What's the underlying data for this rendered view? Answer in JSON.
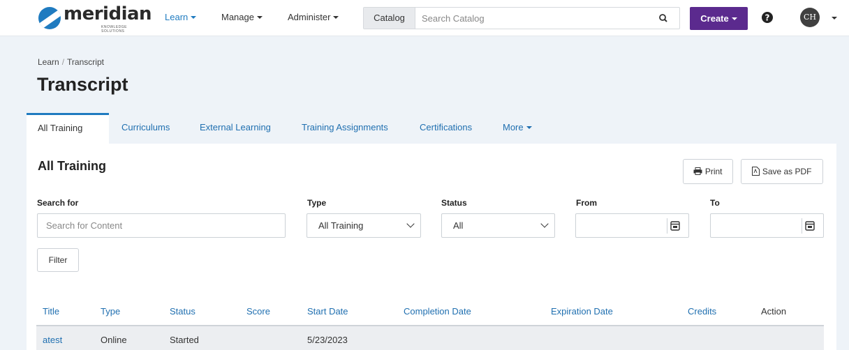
{
  "brand": {
    "name": "meridian",
    "tagline": "KNOWLEDGE SOLUTIONS"
  },
  "nav": {
    "learn": "Learn",
    "manage": "Manage",
    "administer": "Administer",
    "catalog_label": "Catalog",
    "search_placeholder": "Search Catalog",
    "create": "Create",
    "avatar_initials": "CH"
  },
  "breadcrumb": {
    "root": "Learn",
    "current": "Transcript"
  },
  "page_title": "Transcript",
  "tabs": [
    "All Training",
    "Curriculums",
    "External Learning",
    "Training Assignments",
    "Certifications",
    "More"
  ],
  "panel": {
    "title": "All Training",
    "print": "Print",
    "save_pdf": "Save as PDF",
    "filters": {
      "search_label": "Search for",
      "search_placeholder": "Search for Content",
      "type_label": "Type",
      "type_value": "All Training",
      "status_label": "Status",
      "status_value": "All",
      "from_label": "From",
      "to_label": "To",
      "filter_button": "Filter"
    },
    "table": {
      "columns": [
        "Title",
        "Type",
        "Status",
        "Score",
        "Start Date",
        "Completion Date",
        "Expiration Date",
        "Credits",
        "Action"
      ],
      "rows": [
        {
          "title": "atest",
          "type": "Online",
          "status": "Started",
          "score": "",
          "start_date": "5/23/2023",
          "completion_date": "",
          "expiration_date": "",
          "credits": "",
          "action": ""
        }
      ]
    }
  },
  "colors": {
    "brand_blue": "#1f7bc0",
    "link": "#1f6fb0",
    "create_purple": "#5b2a8e",
    "page_bg": "#eef3f8"
  },
  "icons": [
    "search-icon",
    "help-icon",
    "print-icon",
    "pdf-icon",
    "calendar-icon",
    "chevron-down-icon"
  ]
}
